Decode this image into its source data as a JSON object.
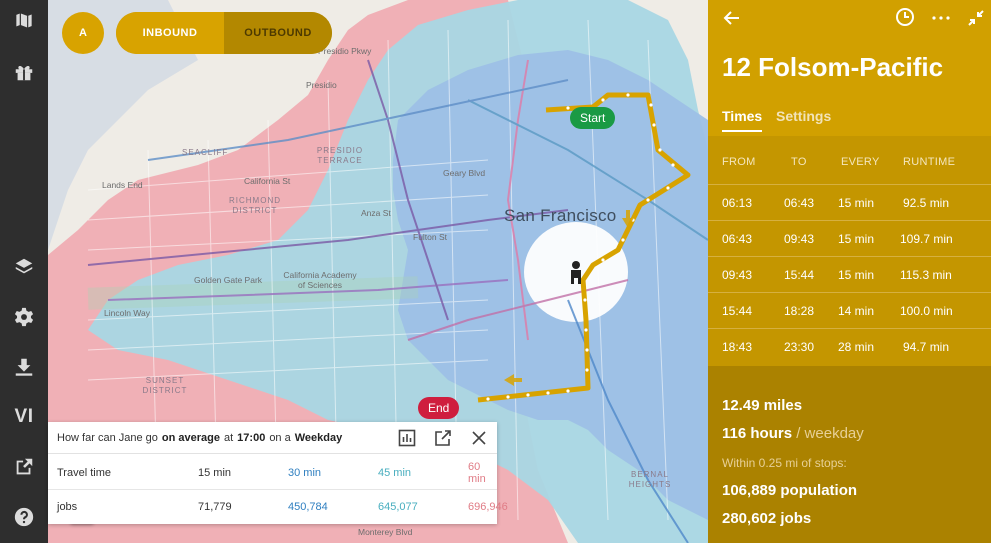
{
  "sidebar": {
    "items": [
      {
        "icon": "map-icon"
      },
      {
        "icon": "gift-icon"
      },
      {
        "icon": "layers-icon"
      },
      {
        "icon": "gear-icon"
      },
      {
        "icon": "download-icon"
      },
      {
        "icon": "vi-icon",
        "label": "VI"
      },
      {
        "icon": "external-link-icon"
      },
      {
        "icon": "help-icon"
      }
    ]
  },
  "map": {
    "variant_label": "A",
    "direction_inbound": "INBOUND",
    "direction_outbound": "OUTBOUND",
    "start_label": "Start",
    "end_label": "End",
    "zoom_in": "+",
    "zoom_out": "−",
    "labels": {
      "city": "San Francisco",
      "presidio": "Presidio",
      "lands_end": "Lands End",
      "seacliff": "SEACLIFF",
      "presidio_terrace": "PRESIDIO TERRACE",
      "richmond_district": "RICHMOND DISTRICT",
      "california_st": "California St",
      "anza_st": "Anza St",
      "golden_gate_park": "Golden Gate Park",
      "academy": "California Academy of Sciences",
      "lincoln_way": "Lincoln Way",
      "sunset_district": "SUNSET DISTRICT",
      "monterey_blvd": "Monterey Blvd",
      "bernal": "BERNAL HEIGHTS",
      "presidio_pkwy": "Presidio Pkwy",
      "fulton_st": "Fulton St",
      "geary_blvd": "Geary Blvd"
    }
  },
  "travel_panel": {
    "q1": "How far can Jane go",
    "q2": "on average",
    "q3": "at",
    "q4": "17:00",
    "q5": "on a",
    "q6": "Weekday",
    "row1_label": "Travel time",
    "row2_label": "jobs",
    "times": [
      "15 min",
      "30 min",
      "45 min",
      "60 min"
    ],
    "jobs": [
      "71,779",
      "450,784",
      "645,077",
      "696,946"
    ],
    "colors": [
      "#222222",
      "#2f7fc0",
      "#48aebf",
      "#e07c86"
    ]
  },
  "route_panel": {
    "title": "12 Folsom-Pacific",
    "tab_times": "Times",
    "tab_settings": "Settings",
    "headers": [
      "FROM",
      "TO",
      "EVERY",
      "RUNTIME"
    ],
    "rows": [
      [
        "06:13",
        "06:43",
        "15 min",
        "92.5 min"
      ],
      [
        "06:43",
        "09:43",
        "15 min",
        "109.7 min"
      ],
      [
        "09:43",
        "15:44",
        "15 min",
        "115.3 min"
      ],
      [
        "15:44",
        "18:28",
        "14 min",
        "100.0 min"
      ],
      [
        "18:43",
        "23:30",
        "28 min",
        "94.7 min"
      ]
    ],
    "miles": "12.49 miles",
    "hours": "116 hours",
    "hours_suffix": "/ weekday",
    "within": "Within 0.25 mi of stops:",
    "population": "106,889 population",
    "jobs": "280,602 jobs"
  }
}
